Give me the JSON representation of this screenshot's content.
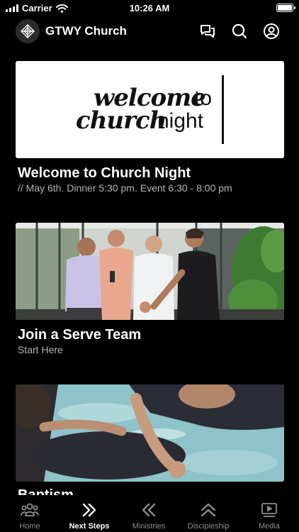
{
  "status_bar": {
    "carrier": "Carrier",
    "time": "10:26 AM"
  },
  "header": {
    "title": "GTWY Church"
  },
  "cards": [
    {
      "image_text": {
        "line1_bold": "welcome",
        "line1_light": "to",
        "line2_bold": "church",
        "line2_light": "night"
      },
      "title": "Welcome to Church Night",
      "subtitle": "// May 6th. Dinner 5:30 pm. Event 6:30 - 8:00 pm"
    },
    {
      "title": "Join a Serve Team",
      "subtitle": "Start Here"
    },
    {
      "title": "Baptism"
    }
  ],
  "tabs": [
    {
      "label": "Home",
      "icon": "people-icon",
      "active": false
    },
    {
      "label": "Next Steps",
      "icon": "double-chevron-right-icon",
      "active": true
    },
    {
      "label": "Ministries",
      "icon": "double-chevron-left-icon",
      "active": false
    },
    {
      "label": "Discipleship",
      "icon": "double-chevron-up-icon",
      "active": false
    },
    {
      "label": "Media",
      "icon": "play-media-icon",
      "active": false
    }
  ]
}
